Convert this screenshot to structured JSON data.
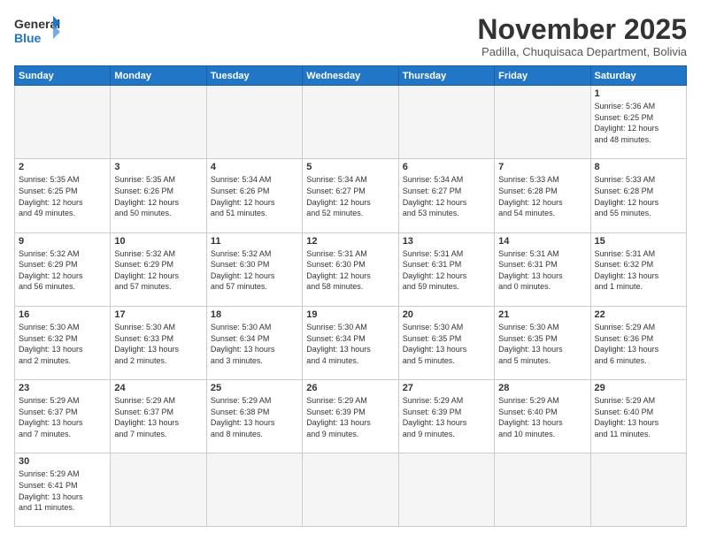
{
  "logo": {
    "text_general": "General",
    "text_blue": "Blue"
  },
  "header": {
    "month_title": "November 2025",
    "subtitle": "Padilla, Chuquisaca Department, Bolivia"
  },
  "weekdays": [
    "Sunday",
    "Monday",
    "Tuesday",
    "Wednesday",
    "Thursday",
    "Friday",
    "Saturday"
  ],
  "weeks": [
    [
      {
        "day": "",
        "info": "",
        "empty": true
      },
      {
        "day": "",
        "info": "",
        "empty": true
      },
      {
        "day": "",
        "info": "",
        "empty": true
      },
      {
        "day": "",
        "info": "",
        "empty": true
      },
      {
        "day": "",
        "info": "",
        "empty": true
      },
      {
        "day": "",
        "info": "",
        "empty": true
      },
      {
        "day": "1",
        "info": "Sunrise: 5:36 AM\nSunset: 6:25 PM\nDaylight: 12 hours\nand 48 minutes."
      }
    ],
    [
      {
        "day": "2",
        "info": "Sunrise: 5:35 AM\nSunset: 6:25 PM\nDaylight: 12 hours\nand 49 minutes."
      },
      {
        "day": "3",
        "info": "Sunrise: 5:35 AM\nSunset: 6:26 PM\nDaylight: 12 hours\nand 50 minutes."
      },
      {
        "day": "4",
        "info": "Sunrise: 5:34 AM\nSunset: 6:26 PM\nDaylight: 12 hours\nand 51 minutes."
      },
      {
        "day": "5",
        "info": "Sunrise: 5:34 AM\nSunset: 6:27 PM\nDaylight: 12 hours\nand 52 minutes."
      },
      {
        "day": "6",
        "info": "Sunrise: 5:34 AM\nSunset: 6:27 PM\nDaylight: 12 hours\nand 53 minutes."
      },
      {
        "day": "7",
        "info": "Sunrise: 5:33 AM\nSunset: 6:28 PM\nDaylight: 12 hours\nand 54 minutes."
      },
      {
        "day": "8",
        "info": "Sunrise: 5:33 AM\nSunset: 6:28 PM\nDaylight: 12 hours\nand 55 minutes."
      }
    ],
    [
      {
        "day": "9",
        "info": "Sunrise: 5:32 AM\nSunset: 6:29 PM\nDaylight: 12 hours\nand 56 minutes."
      },
      {
        "day": "10",
        "info": "Sunrise: 5:32 AM\nSunset: 6:29 PM\nDaylight: 12 hours\nand 57 minutes."
      },
      {
        "day": "11",
        "info": "Sunrise: 5:32 AM\nSunset: 6:30 PM\nDaylight: 12 hours\nand 57 minutes."
      },
      {
        "day": "12",
        "info": "Sunrise: 5:31 AM\nSunset: 6:30 PM\nDaylight: 12 hours\nand 58 minutes."
      },
      {
        "day": "13",
        "info": "Sunrise: 5:31 AM\nSunset: 6:31 PM\nDaylight: 12 hours\nand 59 minutes."
      },
      {
        "day": "14",
        "info": "Sunrise: 5:31 AM\nSunset: 6:31 PM\nDaylight: 13 hours\nand 0 minutes."
      },
      {
        "day": "15",
        "info": "Sunrise: 5:31 AM\nSunset: 6:32 PM\nDaylight: 13 hours\nand 1 minute."
      }
    ],
    [
      {
        "day": "16",
        "info": "Sunrise: 5:30 AM\nSunset: 6:32 PM\nDaylight: 13 hours\nand 2 minutes."
      },
      {
        "day": "17",
        "info": "Sunrise: 5:30 AM\nSunset: 6:33 PM\nDaylight: 13 hours\nand 2 minutes."
      },
      {
        "day": "18",
        "info": "Sunrise: 5:30 AM\nSunset: 6:34 PM\nDaylight: 13 hours\nand 3 minutes."
      },
      {
        "day": "19",
        "info": "Sunrise: 5:30 AM\nSunset: 6:34 PM\nDaylight: 13 hours\nand 4 minutes."
      },
      {
        "day": "20",
        "info": "Sunrise: 5:30 AM\nSunset: 6:35 PM\nDaylight: 13 hours\nand 5 minutes."
      },
      {
        "day": "21",
        "info": "Sunrise: 5:30 AM\nSunset: 6:35 PM\nDaylight: 13 hours\nand 5 minutes."
      },
      {
        "day": "22",
        "info": "Sunrise: 5:29 AM\nSunset: 6:36 PM\nDaylight: 13 hours\nand 6 minutes."
      }
    ],
    [
      {
        "day": "23",
        "info": "Sunrise: 5:29 AM\nSunset: 6:37 PM\nDaylight: 13 hours\nand 7 minutes."
      },
      {
        "day": "24",
        "info": "Sunrise: 5:29 AM\nSunset: 6:37 PM\nDaylight: 13 hours\nand 7 minutes."
      },
      {
        "day": "25",
        "info": "Sunrise: 5:29 AM\nSunset: 6:38 PM\nDaylight: 13 hours\nand 8 minutes."
      },
      {
        "day": "26",
        "info": "Sunrise: 5:29 AM\nSunset: 6:39 PM\nDaylight: 13 hours\nand 9 minutes."
      },
      {
        "day": "27",
        "info": "Sunrise: 5:29 AM\nSunset: 6:39 PM\nDaylight: 13 hours\nand 9 minutes."
      },
      {
        "day": "28",
        "info": "Sunrise: 5:29 AM\nSunset: 6:40 PM\nDaylight: 13 hours\nand 10 minutes."
      },
      {
        "day": "29",
        "info": "Sunrise: 5:29 AM\nSunset: 6:40 PM\nDaylight: 13 hours\nand 11 minutes."
      }
    ],
    [
      {
        "day": "30",
        "info": "Sunrise: 5:29 AM\nSunset: 6:41 PM\nDaylight: 13 hours\nand 11 minutes.",
        "last": true
      },
      {
        "day": "",
        "info": "",
        "empty": true,
        "last": true
      },
      {
        "day": "",
        "info": "",
        "empty": true,
        "last": true
      },
      {
        "day": "",
        "info": "",
        "empty": true,
        "last": true
      },
      {
        "day": "",
        "info": "",
        "empty": true,
        "last": true
      },
      {
        "day": "",
        "info": "",
        "empty": true,
        "last": true
      },
      {
        "day": "",
        "info": "",
        "empty": true,
        "last": true
      }
    ]
  ]
}
